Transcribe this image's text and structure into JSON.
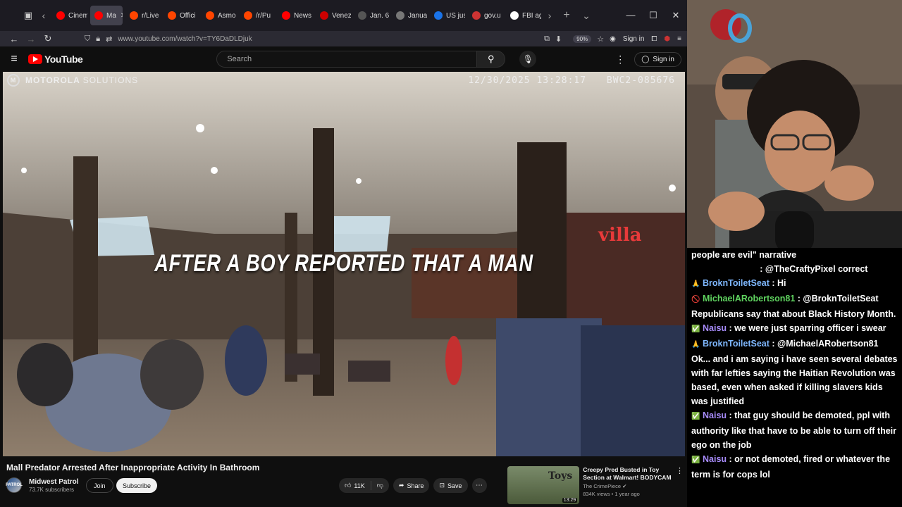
{
  "browser": {
    "tabs": [
      {
        "label": "Cinem",
        "color": "#ff0000"
      },
      {
        "label": "Ma",
        "color": "#ff0000",
        "active": true
      },
      {
        "label": "r/Live",
        "color": "#ff4500"
      },
      {
        "label": "Offici",
        "color": "#ff4500"
      },
      {
        "label": "Asmo",
        "color": "#ff4500"
      },
      {
        "label": "/r/Pu",
        "color": "#ff4500"
      },
      {
        "label": "News",
        "color": "#ff0000"
      },
      {
        "label": "Venez",
        "color": "#cc0000"
      },
      {
        "label": "Jan. 6",
        "color": "#555555"
      },
      {
        "label": "Janua",
        "color": "#777777"
      },
      {
        "label": "US jus",
        "color": "#1a73e8"
      },
      {
        "label": "gov.u",
        "color": "#cc3333"
      },
      {
        "label": "FBI ag",
        "color": "#ffffff"
      }
    ],
    "url": "www.youtube.com/watch?v=TY6DaDLDjuk",
    "zoom": "90%",
    "sign_in": "Sign in"
  },
  "youtube": {
    "logo_text": "YouTube",
    "search_placeholder": "Search",
    "sign_in": "Sign in",
    "video": {
      "brand": "MOTOROLA",
      "brand_suffix": "SOLUTIONS",
      "timestamp": "12/30/2025 13:28:17",
      "camera_id": "BWC2-085676",
      "caption": "AFTER A BOY REPORTED THAT A MAN"
    },
    "title": "Mall Predator Arrested After Inappropriate Activity In Bathroom",
    "channel": {
      "name": "Midwest Patrol",
      "subscribers": "73.7K subscribers",
      "avatar_text": "PATROL"
    },
    "join_label": "Join",
    "subscribe_label": "Subscribe",
    "likes": "11K",
    "share_label": "Share",
    "save_label": "Save",
    "recommended": {
      "title": "Creepy Pred Busted in Toy Section at Walmart! BODYCAM",
      "channel": "The CrimePiece",
      "meta": "834K views • 1 year ago",
      "duration": "13:29",
      "thumb_text": "Toys"
    }
  },
  "chat": {
    "messages": [
      {
        "badge": "",
        "user": "",
        "user_color": "",
        "text": "people are evil\" narrative"
      },
      {
        "badge": "",
        "user": "",
        "user_color": "",
        "text": "                            : @TheCraftyPixel correct"
      },
      {
        "badge": "🙏",
        "user": "BroknToiletSeat",
        "user_color": "blue",
        "text": " : Hi"
      },
      {
        "badge": "🚫",
        "user": "MichaelARobertson81",
        "user_color": "green",
        "text": " : @BroknToiletSeat Republicans say that about Black History Month."
      },
      {
        "badge": "✅",
        "user": "Naisu",
        "user_color": "purple",
        "text": " : we were just sparring officer i swear"
      },
      {
        "badge": "🙏",
        "user": "BroknToiletSeat",
        "user_color": "blue",
        "text": " : @MichaelARobertson81 Ok... and i am saying i have seen several debates with far lefties saying the Haitian Revolution was based, even when asked if killing slavers kids was justified"
      },
      {
        "badge": "✅",
        "user": "Naisu",
        "user_color": "purple",
        "text": " : that guy should be demoted, ppl with authority like that have to be able to turn off their ego on the job"
      },
      {
        "badge": "✅",
        "user": "Naisu",
        "user_color": "purple",
        "text": " : or not demoted, fired or whatever the term is for cops lol"
      }
    ]
  },
  "colors": {
    "youtube_red": "#ff0000",
    "chat_blue": "#7fb8ff",
    "chat_purple": "#a78bfa",
    "chat_green": "#5fd35f"
  }
}
